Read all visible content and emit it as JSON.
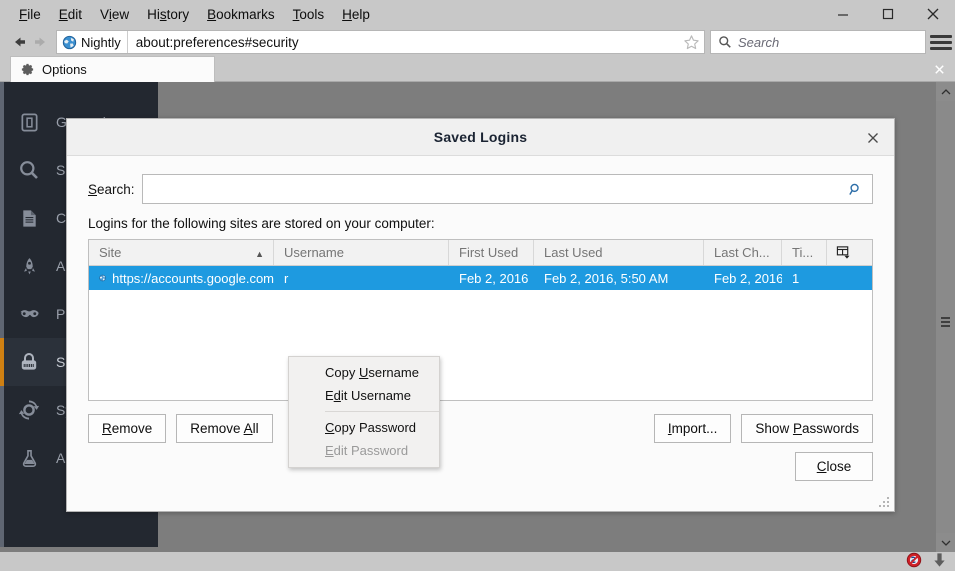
{
  "menubar": {
    "items": [
      {
        "pre": "",
        "key": "F",
        "post": "ile"
      },
      {
        "pre": "",
        "key": "E",
        "post": "dit"
      },
      {
        "pre": "V",
        "key": "i",
        "post": "ew"
      },
      {
        "pre": "Hi",
        "key": "s",
        "post": "tory"
      },
      {
        "pre": "",
        "key": "B",
        "post": "ookmarks"
      },
      {
        "pre": "",
        "key": "T",
        "post": "ools"
      },
      {
        "pre": "",
        "key": "H",
        "post": "elp"
      }
    ]
  },
  "window_controls": {
    "minimize": "minimize-icon",
    "maximize": "maximize-icon",
    "close": "close-icon"
  },
  "navbar": {
    "back": "back-arrow-icon",
    "forward": "forward-arrow-icon",
    "identity_label": "Nightly",
    "url": "about:preferences#security",
    "bookmark_star": "star-icon",
    "search_placeholder": "Search",
    "menu_button": "hamburger-menu-icon"
  },
  "tab": {
    "label": "Options",
    "icon": "gear-icon",
    "close": "close-icon"
  },
  "sidebar": {
    "items": [
      {
        "label": "General",
        "icon": "general-icon",
        "active": false
      },
      {
        "label": "Search",
        "icon": "search-icon",
        "active": false
      },
      {
        "label": "Content",
        "icon": "content-icon",
        "active": false
      },
      {
        "label": "Applications",
        "icon": "rocket-icon",
        "active": false
      },
      {
        "label": "Privacy",
        "icon": "mask-icon",
        "active": false
      },
      {
        "label": "Security",
        "icon": "lock-icon",
        "active": true
      },
      {
        "label": "Sync",
        "icon": "sync-icon",
        "active": false
      },
      {
        "label": "Advanced",
        "icon": "flask-icon",
        "active": false
      }
    ]
  },
  "dialog": {
    "title": "Saved Logins",
    "close_icon": "close-icon",
    "search": {
      "label_pre": "",
      "label_key": "S",
      "label_post": "earch:",
      "value": "",
      "placeholder": "",
      "icon": "magnifier-icon"
    },
    "hint": "Logins for the following sites are stored on your computer:",
    "table": {
      "columns": [
        {
          "label": "Site",
          "sorted": "asc",
          "sort_icon": "sort-ascending-icon"
        },
        {
          "label": "Username",
          "sorted": ""
        },
        {
          "label": "First Used",
          "sorted": ""
        },
        {
          "label": "Last Used",
          "sorted": ""
        },
        {
          "label": "Last Ch...",
          "sorted": ""
        },
        {
          "label": "Ti...",
          "sorted": ""
        }
      ],
      "column_picker_icon": "column-picker-icon",
      "rows": [
        {
          "favicon": "globe-icon",
          "site": "https://accounts.google.com",
          "username": "r",
          "first_used": "Feb 2, 2016",
          "last_used": "Feb 2, 2016, 5:50 AM",
          "last_changed": "Feb 2, 2016",
          "times_used": "1",
          "selected": true
        }
      ]
    },
    "buttons": {
      "remove": {
        "pre": "",
        "key": "R",
        "post": "emove"
      },
      "remove_all": {
        "pre": "Remove ",
        "key": "A",
        "post": "ll"
      },
      "import": {
        "pre": "",
        "key": "I",
        "post": "mport..."
      },
      "show_passwords": {
        "pre": "Show ",
        "key": "P",
        "post": "asswords"
      },
      "close": {
        "pre": "",
        "key": "C",
        "post": "lose"
      }
    },
    "resize_grip": "resize-grip-icon"
  },
  "context_menu": {
    "items": [
      {
        "pre": "Copy ",
        "key": "U",
        "post": "sername",
        "disabled": false,
        "separator_after": false
      },
      {
        "pre": "E",
        "key": "d",
        "post": "it Username",
        "disabled": false,
        "separator_after": true
      },
      {
        "pre": "",
        "key": "C",
        "post": "opy Password",
        "disabled": false,
        "separator_after": false
      },
      {
        "pre": "",
        "key": "E",
        "post": "dit Password",
        "disabled": true,
        "separator_after": false
      }
    ]
  },
  "statusbar": {
    "blocked_icon": "no-entry-icon",
    "download_icon": "download-arrow-icon"
  },
  "scrollbar": {
    "up": "scroll-up-arrow-icon",
    "down": "scroll-down-arrow-icon",
    "grip": "scrollbar-grip-icon"
  },
  "colors": {
    "chrome_bg": "#c8c8c8",
    "page_bg": "#7d7d7d",
    "sidebar_bg": "#232830",
    "accent_selected_row": "#1e9ae0",
    "active_indicator": "#cf8012",
    "dialog_bg": "#fbfbfb"
  }
}
